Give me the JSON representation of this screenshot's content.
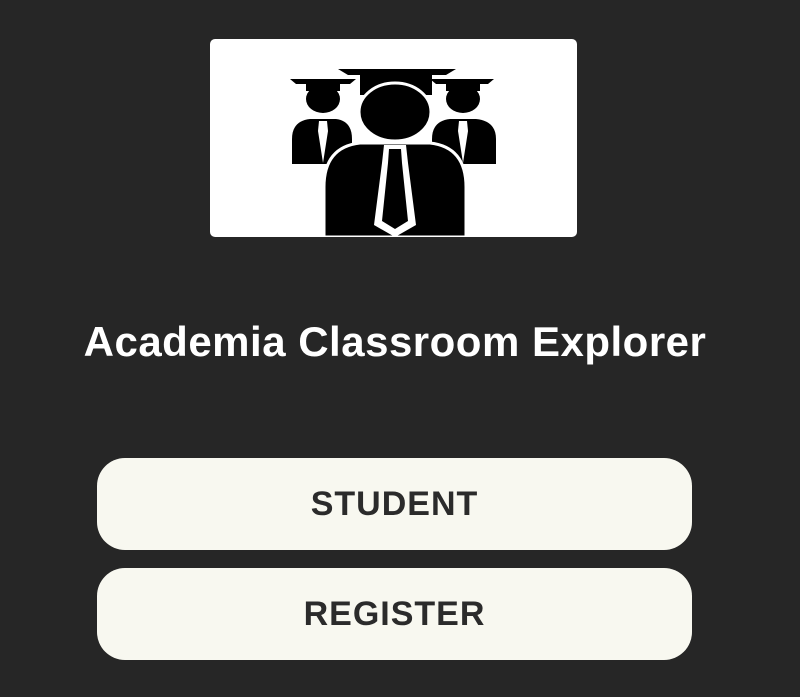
{
  "app": {
    "title": "Academia Classroom Explorer",
    "logo_icon": "graduates-group-icon"
  },
  "buttons": {
    "student_label": "STUDENT",
    "register_label": "REGISTER"
  },
  "colors": {
    "background": "#262626",
    "button_background": "#f8f8f0",
    "button_text": "#2b2b2b",
    "title_text": "#ffffff"
  }
}
